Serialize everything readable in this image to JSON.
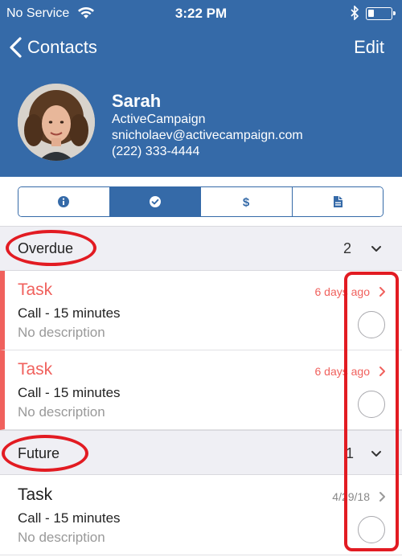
{
  "status_bar": {
    "carrier": "No Service",
    "time": "3:22 PM",
    "wifi_icon": "wifi-icon",
    "bluetooth_icon": "bluetooth-icon",
    "battery_icon": "battery-icon"
  },
  "nav": {
    "back_label": "Contacts",
    "edit_label": "Edit"
  },
  "contact": {
    "name": "Sarah",
    "company": "ActiveCampaign",
    "email": "snicholaev@activecampaign.com",
    "phone": "(222) 333-4444"
  },
  "tabs": [
    {
      "icon": "info-icon",
      "active": false
    },
    {
      "icon": "checkmark-icon",
      "active": true
    },
    {
      "icon": "dollar-icon",
      "active": false
    },
    {
      "icon": "document-icon",
      "active": false
    }
  ],
  "sections": {
    "overdue": {
      "title": "Overdue",
      "count": "2",
      "tasks": [
        {
          "title": "Task",
          "type": "Call - 15 minutes",
          "description": "No description",
          "date": "6 days ago"
        },
        {
          "title": "Task",
          "type": "Call - 15 minutes",
          "description": "No description",
          "date": "6 days ago"
        }
      ]
    },
    "future": {
      "title": "Future",
      "count": "1",
      "tasks": [
        {
          "title": "Task",
          "type": "Call - 15 minutes",
          "description": "No description",
          "date": "4/29/18"
        }
      ]
    }
  },
  "colors": {
    "header_blue": "#356aa8",
    "overdue_red": "#f0615d",
    "annotation_red": "#e21b22",
    "section_gray": "#efeff4"
  }
}
